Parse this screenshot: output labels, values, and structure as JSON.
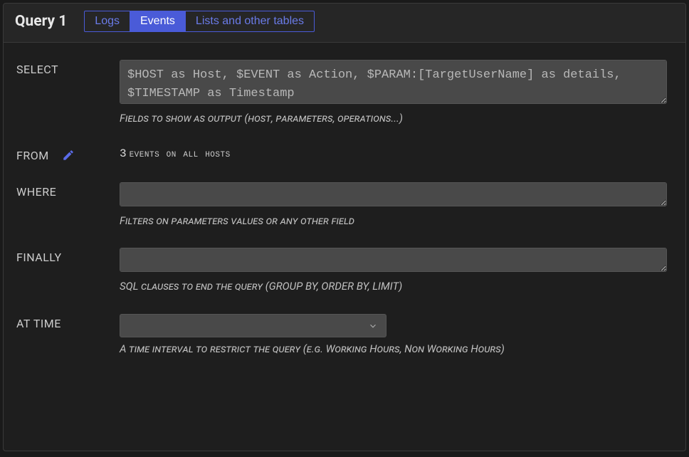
{
  "header": {
    "title": "Query 1",
    "tabs": {
      "logs": "Logs",
      "events": "Events",
      "lists": "Lists and other tables"
    }
  },
  "fields": {
    "select": {
      "label": "SELECT",
      "value": "$HOST as Host, $EVENT as Action, $PARAM:[TargetUserName] as details, $TIMESTAMP as Timestamp",
      "hint": "Fields to show as output (host, parameters, operations...)"
    },
    "from": {
      "label": "FROM",
      "value_count": "3",
      "value_text": "events on all hosts"
    },
    "where": {
      "label": "WHERE",
      "value": "",
      "hint": "Filters on parameters values or any other field"
    },
    "finally": {
      "label": "FINALLY",
      "value": "",
      "hint": "SQL clauses to end the query (GROUP BY, ORDER BY, LIMIT)"
    },
    "at_time": {
      "label": "AT TIME",
      "value": "",
      "hint": "A time interval to restrict the query (e.g. Working Hours, Non Working Hours)"
    }
  }
}
